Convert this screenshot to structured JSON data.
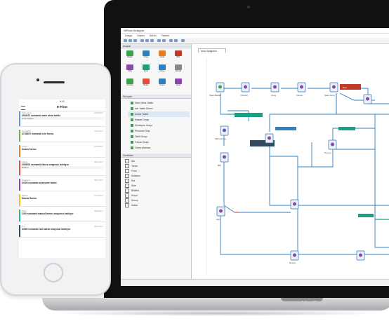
{
  "laptop": {
    "brand": "MacBook",
    "app": {
      "title": "WFlow Designer",
      "menu": [
        "Dosya",
        "Düzen",
        "Görün",
        "Yardım"
      ],
      "palette_header": "Araçlar",
      "palette_items": [
        "Başla",
        "Onay",
        "Karar",
        "Bitir",
        "Mail",
        "Form",
        "Görev",
        "Döngü",
        "Alt Akış",
        "Bekle",
        "Koşul",
        "Hata"
      ],
      "tree_header": "Süreçler",
      "tree_items": [
        "Satın Alma Talebi",
        "İzin Talebi Süreci",
        "Avans Talebi",
        "Masraf Onayı",
        "Sözleşme Onayı",
        "Personel Giriş",
        "Teklif Onayı",
        "Fatura Onayı",
        "Görev Ataması"
      ],
      "tree_selected_index": 2,
      "objects_header": "Özellikler",
      "objects_items": [
        "Adı",
        "Tanım",
        "Form",
        "Kullanıcı",
        "Rol",
        "Süre",
        "Bildirim",
        "Koşul",
        "Sonuç",
        "Notlar"
      ],
      "canvas_tab": "Akış Diyagramı",
      "status_text": "",
      "flow_node_labels": [
        "Talep Başlat",
        "Yönetici",
        "Onay",
        "Finans",
        "Satın Alma",
        "Mail Gönder",
        "Kontrol",
        "Bitir",
        "Arşiv",
        "Red",
        "Revize"
      ]
    }
  },
  "phone": {
    "status_time": "9:41",
    "app_title": "E-Flow",
    "cards": [
      {
        "meta": "Satın Alma",
        "title": "2003/21 numaralı satın alma talebi",
        "sub": "Onay bekliyor",
        "date": "12.03.2017",
        "color": "#5b9bd5"
      },
      {
        "meta": "İzin Talebi",
        "title": "4738957 numaralı izin formu",
        "sub": "",
        "date": "11.03.2017",
        "color": "#70ad47"
      },
      {
        "meta": "Avans",
        "title": "Avans formu",
        "sub": "",
        "date": "10.03.2017",
        "color": "#ed7d31"
      },
      {
        "meta": "Fatura",
        "title": "2405/03 numaralı fatura onayınızı bekliyor",
        "sub": "Bekliyor",
        "date": "09.03.2017",
        "color": "#e84c3d"
      },
      {
        "meta": "Sözleşme",
        "title": "3/100 numaralı sözleşme talebi",
        "sub": "",
        "date": "08.03.2017",
        "color": "#8e44ad"
      },
      {
        "meta": "Masraf",
        "title": "Masraf formu",
        "sub": "",
        "date": "07.03.2017",
        "color": "#f1c40f"
      },
      {
        "meta": "Talep",
        "title": "1/00 numaralı masraf formu onayınızı bekliyor",
        "sub": "",
        "date": "06.03.2017",
        "color": "#1abc9c"
      },
      {
        "meta": "İzin",
        "title": "4/000 numaralı izin talebi onayınızı bekliyor",
        "sub": "",
        "date": "05.03.2017",
        "color": "#34495e"
      }
    ]
  },
  "colors": {
    "connector": "#2f7fc1",
    "accent_red": "#c0392b",
    "accent_teal": "#16a085",
    "accent_navy": "#34495e"
  }
}
